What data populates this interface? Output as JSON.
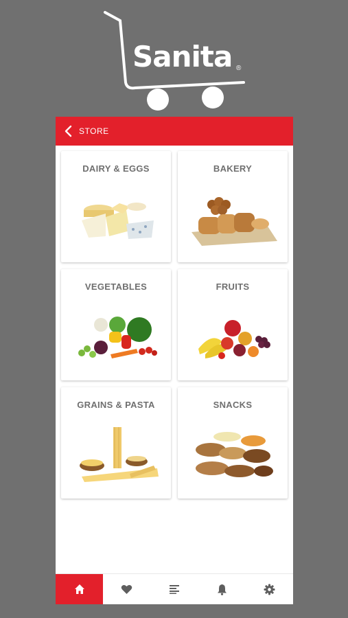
{
  "brand": {
    "logo_text": "Sanita",
    "registered_mark": "®"
  },
  "header": {
    "title": "STORE",
    "back_icon": "chevron-left-icon"
  },
  "categories": [
    {
      "label": "DAIRY & EGGS",
      "icon": "dairy-image"
    },
    {
      "label": "BAKERY",
      "icon": "bakery-image"
    },
    {
      "label": "VEGETABLES",
      "icon": "vegetables-image"
    },
    {
      "label": "FRUITS",
      "icon": "fruits-image"
    },
    {
      "label": "GRAINS & PASTA",
      "icon": "grains-pasta-image"
    },
    {
      "label": "SNACKS",
      "icon": "snacks-image"
    }
  ],
  "bottom_nav": [
    {
      "icon": "home-icon",
      "active": true
    },
    {
      "icon": "heart-icon",
      "active": false
    },
    {
      "icon": "list-icon",
      "active": false
    },
    {
      "icon": "bell-icon",
      "active": false
    },
    {
      "icon": "gear-icon",
      "active": false
    }
  ],
  "colors": {
    "accent": "#e3202b",
    "background": "#707070",
    "card_text": "#6f6f6f"
  }
}
